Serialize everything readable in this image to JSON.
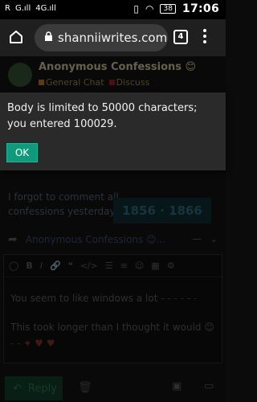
{
  "status_bar": {
    "carrier": "R",
    "signal": "G.ıll",
    "network": "4G.ıll",
    "battery": "38",
    "time": "17:06"
  },
  "browser": {
    "url": "shanniiwrites.com",
    "tab_count": "4"
  },
  "topic": {
    "title": "Anonymous Confessions 😊",
    "categories": [
      {
        "label": "General Chat",
        "color": "#a86a1a"
      },
      {
        "label": "Discuss",
        "color": "#8a1a1a"
      }
    ]
  },
  "post": {
    "text": "I forgot to comment all confessions yesterday 😊",
    "counter": "1856 · 1866"
  },
  "reply_to": {
    "topic": "Anonymous Confessions 😊..."
  },
  "composer": {
    "lines": [
      "You seem to like windows a lot",
      "This took longer than I thought it would 😊"
    ]
  },
  "bottom_bar": {
    "reply_label": "Reply"
  },
  "dialog": {
    "message": "Body is limited to 50000 characters; you entered 100029.",
    "ok_label": "OK"
  },
  "colors": {
    "ok_button": "#109a7b",
    "dialog_bg": "#2a2a2a"
  }
}
